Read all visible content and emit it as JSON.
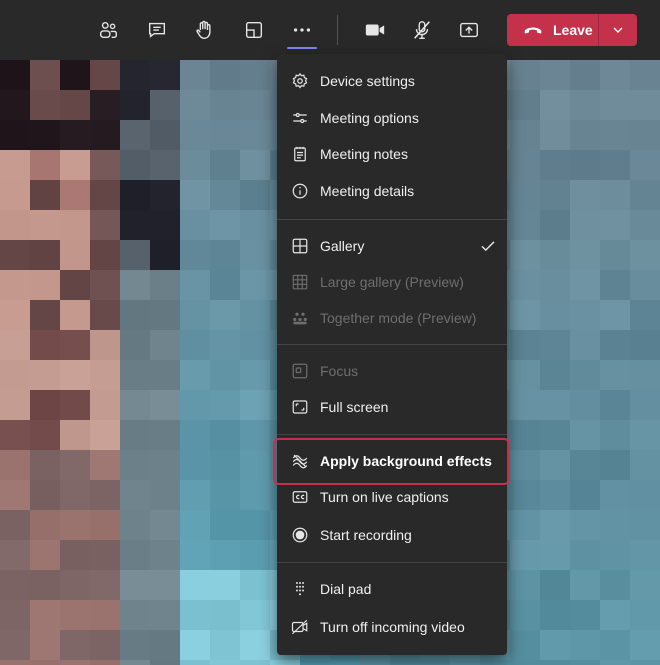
{
  "toolbar": {
    "buttons": [
      {
        "name": "participants-icon",
        "label": "Show participants"
      },
      {
        "name": "chat-icon",
        "label": "Show conversation"
      },
      {
        "name": "raise-hand-icon",
        "label": "Raise your hand"
      },
      {
        "name": "rooms-icon",
        "label": "Breakout rooms"
      },
      {
        "name": "more-actions-icon",
        "label": "More actions"
      },
      {
        "name": "camera-icon",
        "label": "Turn camera off"
      },
      {
        "name": "mic-off-icon",
        "label": "Unmute"
      },
      {
        "name": "share-icon",
        "label": "Share content"
      }
    ],
    "leave_label": "Leave",
    "accent_color": "#c4314b",
    "active_indicator_color": "#7f85f5"
  },
  "menu": {
    "sections": [
      {
        "items": [
          {
            "label": "Device settings",
            "icon": "gear-icon",
            "enabled": true
          },
          {
            "label": "Meeting options",
            "icon": "sliders-icon",
            "enabled": true
          },
          {
            "label": "Meeting notes",
            "icon": "notes-icon",
            "enabled": true
          },
          {
            "label": "Meeting details",
            "icon": "info-icon",
            "enabled": true
          }
        ]
      },
      {
        "items": [
          {
            "label": "Gallery",
            "icon": "gallery-icon",
            "enabled": true,
            "checked": true
          },
          {
            "label": "Large gallery (Preview)",
            "icon": "large-gallery-icon",
            "enabled": false
          },
          {
            "label": "Together mode (Preview)",
            "icon": "together-mode-icon",
            "enabled": false
          }
        ]
      },
      {
        "items": [
          {
            "label": "Focus",
            "icon": "focus-icon",
            "enabled": false
          },
          {
            "label": "Full screen",
            "icon": "fullscreen-icon",
            "enabled": true
          }
        ]
      },
      {
        "items": [
          {
            "label": "Apply background effects",
            "icon": "background-effects-icon",
            "enabled": true,
            "highlighted": true
          },
          {
            "label": "Turn on live captions",
            "icon": "captions-icon",
            "enabled": true
          },
          {
            "label": "Start recording",
            "icon": "record-icon",
            "enabled": true
          }
        ]
      },
      {
        "items": [
          {
            "label": "Dial pad",
            "icon": "dialpad-icon",
            "enabled": true
          },
          {
            "label": "Turn off incoming video",
            "icon": "video-off-icon",
            "enabled": true
          }
        ]
      }
    ]
  }
}
